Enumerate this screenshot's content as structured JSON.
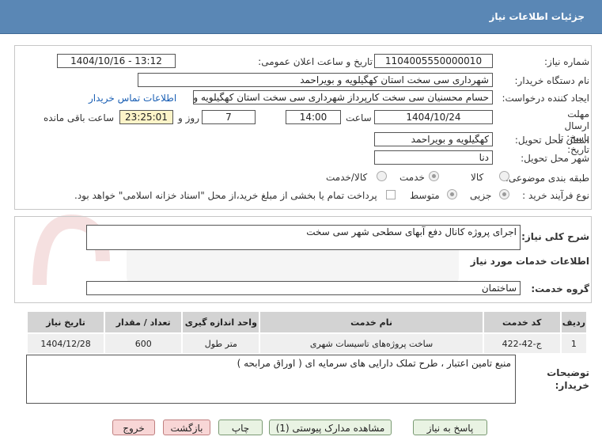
{
  "header": {
    "title": "جزئیات اطلاعات نیاز"
  },
  "form": {
    "need_number": {
      "label": "شماره نیاز:",
      "value": "1104005550000010"
    },
    "announce": {
      "label": "تاریخ و ساعت اعلان عمومی:",
      "value": "1404/10/16 - 13:12"
    },
    "buyer": {
      "label": "نام دستگاه خریدار:",
      "value": "شهرداری سی سخت استان کهگیلویه و بویراحمد"
    },
    "creator": {
      "label": "ایجاد کننده درخواست:",
      "value": "حسام محسنیان سی سخت کارپرداز شهرداری سی سخت استان کهگیلویه و بویراحمد",
      "contact_link": "اطلاعات تماس خریدار"
    },
    "deadline": {
      "label": "مهلت ارسال پاسخ: تا تاریخ:",
      "date": "1404/10/24",
      "time_label": "ساعت",
      "time": "14:00",
      "days": "7",
      "days_label": "روز و",
      "remaining": "23:25:01",
      "remaining_label": "ساعت باقی مانده"
    },
    "province": {
      "label": "استان محل تحویل:",
      "value": "کهگیلویه و بویراحمد"
    },
    "city": {
      "label": "شهر محل تحویل:",
      "value": "دنا"
    },
    "category": {
      "label": "طبقه بندی موضوعی:",
      "options": [
        "کالا",
        "خدمت",
        "کالا/خدمت"
      ],
      "selected": "خدمت"
    },
    "purchase": {
      "label": "نوع فرآیند خرید :",
      "options": [
        "جزیی",
        "متوسط"
      ],
      "selected": "جزیی",
      "payment_note": "پرداخت تمام یا بخشی از مبلغ خرید،از محل \"اسناد خزانه اسلامی\" خواهد بود."
    }
  },
  "summary": {
    "label": "شرح کلی نیاز:",
    "value": "اجرای پروژه کانال دفع آبهای سطحی شهر سی سخت"
  },
  "services_title": "اطلاعات خدمات مورد نیاز",
  "service_group": {
    "label": "گروه خدمت:",
    "value": "ساختمان"
  },
  "table": {
    "headers": [
      "ردیف",
      "کد خدمت",
      "نام خدمت",
      "واحد اندازه گیری",
      "تعداد / مقدار",
      "تاریخ نیاز"
    ],
    "rows": [
      [
        "1",
        "ج-42-422",
        "ساخت پروژه‌های تاسیسات شهری",
        "متر طول",
        "600",
        "1404/12/28"
      ]
    ]
  },
  "notes": {
    "label": "توضیحات خریدار:",
    "value": "منبع تامین اعتبار ، طرح تملک دارایی های سرمایه ای ( اوراق مرابحه )"
  },
  "buttons": {
    "reply": "پاسخ به نیاز",
    "attachments": "مشاهده مدارک پیوستی (1)",
    "print": "چاپ",
    "back": "بازگشت",
    "exit": "خروج"
  },
  "colors": {
    "header": "#5a87b5",
    "highlight": "#fdf4c8",
    "button": "#e9f3e3",
    "button_red": "#f8d6d6"
  }
}
